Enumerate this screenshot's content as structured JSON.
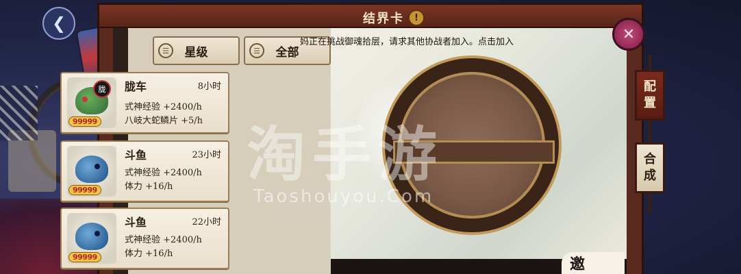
{
  "header": {
    "title": "结界卡",
    "title_badge": "!"
  },
  "back_button": {
    "icon": "back-arrow-icon",
    "glyph": "❮"
  },
  "close_button": {
    "icon": "close-icon",
    "glyph": "✕"
  },
  "filters": [
    {
      "label": "星级",
      "icon": "sort-icon"
    },
    {
      "label": "全部",
      "icon": "sort-icon"
    }
  ],
  "cards": [
    {
      "name": "胧车",
      "time": "8小时",
      "line1": "式神经验 +2400/h",
      "line2": "八岐大蛇鳞片 +5/h",
      "rating": "99999",
      "portrait_icon": "oboroguruma-portrait-icon",
      "badge": "胧"
    },
    {
      "name": "斗鱼",
      "time": "23小时",
      "line1": "式神经验 +2400/h",
      "line2": "体力 +16/h",
      "rating": "99999",
      "portrait_icon": "fighting-fish-portrait-icon",
      "badge": ""
    },
    {
      "name": "斗鱼",
      "time": "22小时",
      "line1": "式神经验 +2400/h",
      "line2": "体力 +16/h",
      "rating": "99999",
      "portrait_icon": "fighting-fish-portrait-icon",
      "badge": ""
    }
  ],
  "notice": "妈正在挑战御魂拾层，请求其他协战者加入。点击加入",
  "side_tabs": [
    {
      "label_top": "配",
      "label_bottom": "置",
      "active": true
    },
    {
      "label_top": "合",
      "label_bottom": "成",
      "active": false
    }
  ],
  "invite_button": {
    "label": "邀"
  },
  "watermark": {
    "main": "淘手游",
    "sub": "Taoshouyou.Com"
  },
  "colors": {
    "frame": "#5a2a1e",
    "accent_gold": "#c29a5a",
    "rating": "#b3261e",
    "close": "#c64a78"
  }
}
